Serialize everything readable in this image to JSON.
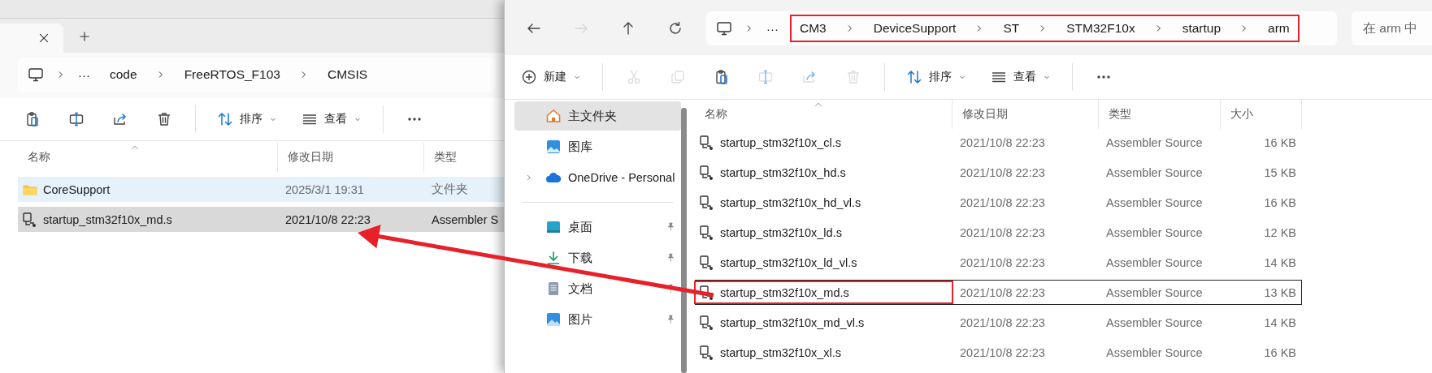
{
  "left_window": {
    "address": {
      "ellipsis": "···",
      "path": [
        "code",
        "FreeRTOS_F103",
        "CMSIS"
      ],
      "highlighted": false
    },
    "toolbar": [
      {
        "kind": "paste",
        "disabled": false
      },
      {
        "kind": "rename",
        "disabled": false
      },
      {
        "kind": "share",
        "disabled": false
      },
      {
        "kind": "delete",
        "disabled": false
      },
      {
        "kind": "sort",
        "label": "排序"
      },
      {
        "kind": "view",
        "label": "查看"
      },
      {
        "kind": "more"
      }
    ],
    "columns": [
      "名称",
      "修改日期",
      "类型"
    ],
    "rows": [
      {
        "kind": "folder",
        "name": "CoreSupport",
        "date": "2025/3/1 19:31",
        "type": "文件夹",
        "selected": false,
        "hovered": true
      },
      {
        "kind": "source",
        "name": "startup_stm32f10x_md.s",
        "date": "2021/10/8 22:23",
        "type": "Assembler S",
        "selected": true,
        "hovered": false
      }
    ]
  },
  "right_window": {
    "nav_buttons": [
      {
        "kind": "back",
        "disabled": false
      },
      {
        "kind": "forward",
        "disabled": true
      },
      {
        "kind": "up",
        "disabled": false
      },
      {
        "kind": "refresh",
        "disabled": false
      }
    ],
    "address": {
      "ellipsis": "···",
      "path": [
        "CM3",
        "DeviceSupport",
        "ST",
        "STM32F10x",
        "startup",
        "arm"
      ],
      "highlighted": true
    },
    "search": {
      "placeholder": "在 arm 中"
    },
    "toolbar": [
      {
        "kind": "new",
        "label": "新建"
      },
      {
        "kind": "cut",
        "disabled": true
      },
      {
        "kind": "copy",
        "disabled": true
      },
      {
        "kind": "paste",
        "disabled": false
      },
      {
        "kind": "rename",
        "disabled": true
      },
      {
        "kind": "share",
        "disabled": true
      },
      {
        "kind": "delete",
        "disabled": true
      },
      {
        "kind": "sort",
        "label": "排序"
      },
      {
        "kind": "view",
        "label": "查看"
      },
      {
        "kind": "more"
      }
    ],
    "sidebar": {
      "groups": [
        [
          {
            "kind": "home",
            "label": "主文件夹",
            "selected": true,
            "expandable": false,
            "pinned": false
          },
          {
            "kind": "gallery",
            "label": "图库",
            "selected": false,
            "expandable": false,
            "pinned": false
          },
          {
            "kind": "cloud",
            "label": "OneDrive - Personal",
            "selected": false,
            "expandable": true,
            "pinned": false
          }
        ],
        [
          {
            "kind": "desktop",
            "label": "桌面",
            "selected": false,
            "expandable": false,
            "pinned": true
          },
          {
            "kind": "downloads",
            "label": "下载",
            "selected": false,
            "expandable": false,
            "pinned": true
          },
          {
            "kind": "documents",
            "label": "文档",
            "selected": false,
            "expandable": false,
            "pinned": true
          },
          {
            "kind": "pictures",
            "label": "图片",
            "selected": false,
            "expandable": false,
            "pinned": true
          }
        ]
      ]
    },
    "columns": [
      "名称",
      "修改日期",
      "类型",
      "大小"
    ],
    "rows": [
      {
        "kind": "source",
        "name": "startup_stm32f10x_cl.s",
        "date": "2021/10/8 22:23",
        "type": "Assembler Source",
        "size": "16 KB",
        "focused": false,
        "highlighted": false
      },
      {
        "kind": "source",
        "name": "startup_stm32f10x_hd.s",
        "date": "2021/10/8 22:23",
        "type": "Assembler Source",
        "size": "15 KB",
        "focused": false,
        "highlighted": false
      },
      {
        "kind": "source",
        "name": "startup_stm32f10x_hd_vl.s",
        "date": "2021/10/8 22:23",
        "type": "Assembler Source",
        "size": "16 KB",
        "focused": false,
        "highlighted": false
      },
      {
        "kind": "source",
        "name": "startup_stm32f10x_ld.s",
        "date": "2021/10/8 22:23",
        "type": "Assembler Source",
        "size": "12 KB",
        "focused": false,
        "highlighted": false
      },
      {
        "kind": "source",
        "name": "startup_stm32f10x_ld_vl.s",
        "date": "2021/10/8 22:23",
        "type": "Assembler Source",
        "size": "14 KB",
        "focused": false,
        "highlighted": false
      },
      {
        "kind": "source",
        "name": "startup_stm32f10x_md.s",
        "date": "2021/10/8 22:23",
        "type": "Assembler Source",
        "size": "13 KB",
        "focused": true,
        "highlighted": true
      },
      {
        "kind": "source",
        "name": "startup_stm32f10x_md_vl.s",
        "date": "2021/10/8 22:23",
        "type": "Assembler Source",
        "size": "14 KB",
        "focused": false,
        "highlighted": false
      },
      {
        "kind": "source",
        "name": "startup_stm32f10x_xl.s",
        "date": "2021/10/8 22:23",
        "type": "Assembler Source",
        "size": "16 KB",
        "focused": false,
        "highlighted": false
      }
    ]
  }
}
